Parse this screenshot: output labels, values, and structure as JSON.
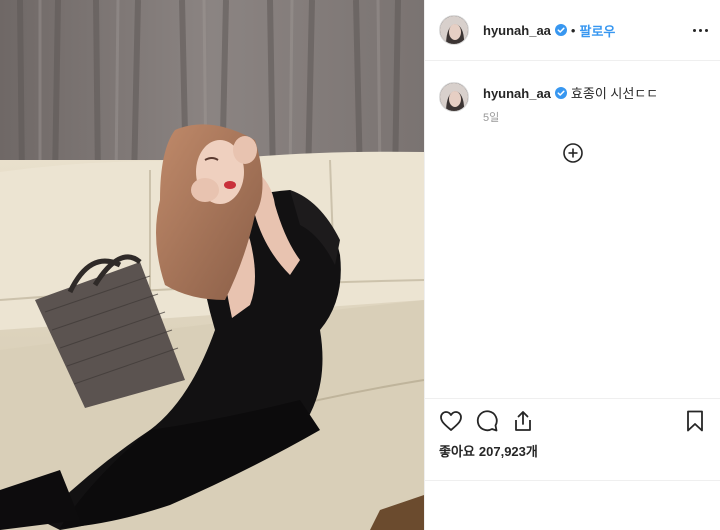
{
  "post": {
    "username": "hyunah_aa",
    "follow_label": "팔로우",
    "separator": "•",
    "caption": "효종이 시선ㄷㄷ",
    "time_ago": "5일",
    "likes_label": "좋아요",
    "likes_count": "207,923개"
  },
  "icons": {
    "verified": "verified-badge-icon",
    "more": "more-options-icon",
    "load_more": "plus-circle-icon",
    "like": "heart-icon",
    "comment": "comment-icon",
    "share": "share-icon",
    "save": "bookmark-icon"
  },
  "colors": {
    "link_blue": "#3897f0",
    "text": "#262626",
    "muted": "#999999",
    "divider": "#efefef"
  }
}
